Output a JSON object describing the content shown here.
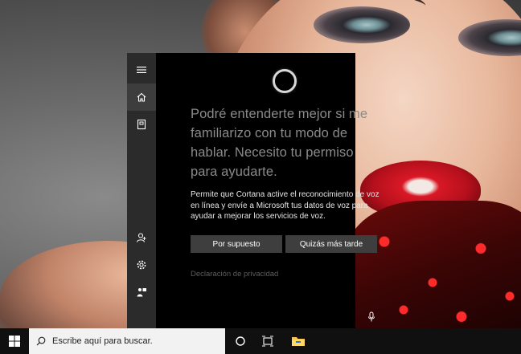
{
  "cortana": {
    "headline": "Podré entenderte mejor si me familiarizo con tu modo de hablar. Necesito tu permiso para ayudarte.",
    "body": "Permite que Cortana active el reconocimiento de voz en línea y envíe a Microsoft tus datos de voz para ayudar a mejorar los servicios de voz.",
    "accept_label": "Por supuesto",
    "decline_label": "Quizás más tarde",
    "privacy_link": "Declaración de privacidad"
  },
  "rail": {
    "icons": [
      "menu-icon",
      "home-icon",
      "notebook-icon",
      "person-icon",
      "gear-icon",
      "feedback-icon"
    ]
  },
  "taskbar": {
    "search_placeholder": "Escribe aquí para buscar.",
    "icons": [
      "windows-logo-icon",
      "search-icon",
      "cortana-circle-icon",
      "task-view-icon",
      "file-explorer-icon"
    ]
  },
  "colors": {
    "panel_bg": "#000000",
    "rail_bg": "#2b2b2b",
    "button_bg": "#3e3e3e",
    "headline_text": "#8a8a8a",
    "taskbar_bg": "#101010",
    "accent_blue": "#0078d7"
  }
}
